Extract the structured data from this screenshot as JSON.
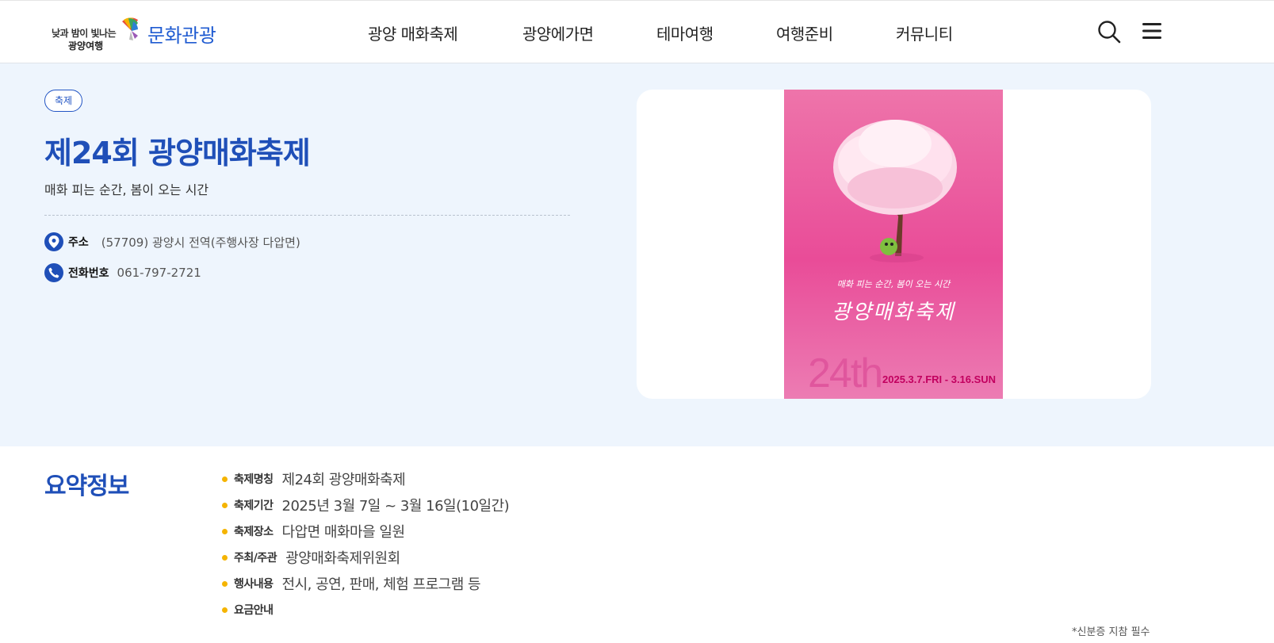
{
  "header": {
    "logo_line1": "낮과 밤이 빛나는",
    "logo_line2": "광양여행",
    "site_name": "문화관광",
    "nav": [
      "광양 매화축제",
      "광양에가면",
      "테마여행",
      "여행준비",
      "커뮤니티"
    ],
    "icons": [
      "search-icon",
      "hamburger-menu-icon"
    ]
  },
  "hero": {
    "badge": "축제",
    "title": "제24회 광양매화축제",
    "subtitle": "매화 피는 순간, 봄이 오는 시간",
    "address_label": "주소",
    "address_value": "(57709) 광양시 전역(주행사장 다압면)",
    "phone_label": "전화번호",
    "phone_value": "061-797-2721",
    "poster": {
      "tagline": "매화 피는 순간, 봄이 오는 시간",
      "title": "광양매화축제",
      "edition": "24th",
      "dates": "2025.3.7.FRI - 3.16.SUN",
      "colors": {
        "background": "#e94c98",
        "accent": "#c2005f"
      }
    }
  },
  "summary": {
    "heading": "요약정보",
    "items": [
      {
        "label": "축제명칭",
        "value": "제24회 광양매화축제"
      },
      {
        "label": "축제기간",
        "value": "2025년 3월 7일 ~ 3월 16일(10일간)"
      },
      {
        "label": "축제장소",
        "value": "다압면 매화마을 일원"
      },
      {
        "label": "주최/주관",
        "value": "광양매화축제위원회"
      },
      {
        "label": "행사내용",
        "value": "전시, 공연, 판매, 체험 프로그램 등"
      },
      {
        "label": "요금안내",
        "value": ""
      }
    ],
    "note": "*신분증 지참 필수"
  }
}
